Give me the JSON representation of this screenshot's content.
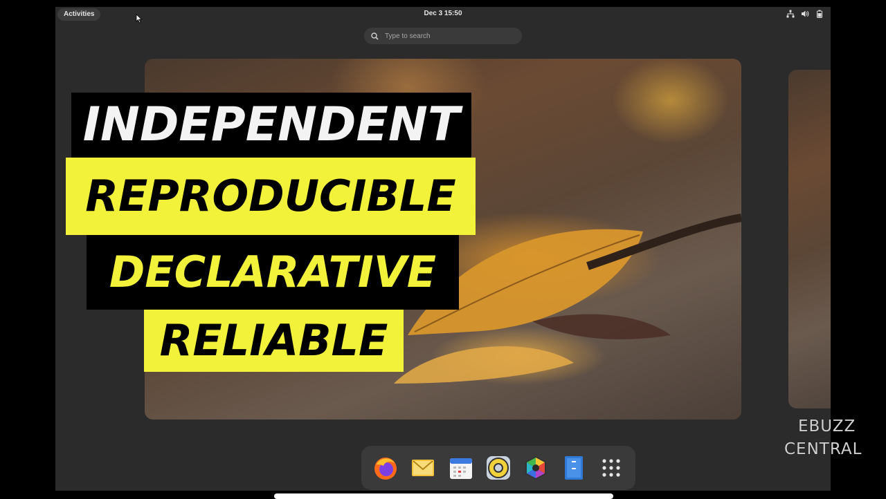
{
  "topbar": {
    "activities_label": "Activities",
    "clock": "Dec 3  15:50",
    "tray": [
      "network-icon",
      "volume-icon",
      "battery-icon"
    ]
  },
  "search": {
    "placeholder": "Type to search"
  },
  "overlay": {
    "line1": "INDEPENDENT",
    "line2": "REPRODUCIBLE",
    "line3": "DECLARATIVE",
    "line4": "RELIABLE"
  },
  "colors": {
    "highlight_yellow": "#f2f23a",
    "panel_bg": "#2b2b2b",
    "dock_bg": "#3a3a3a"
  },
  "dock": {
    "items": [
      {
        "name": "firefox-icon",
        "interactable": true
      },
      {
        "name": "mail-icon",
        "interactable": true
      },
      {
        "name": "calendar-icon",
        "interactable": true
      },
      {
        "name": "rhythmbox-icon",
        "interactable": true
      },
      {
        "name": "photos-icon",
        "interactable": true
      },
      {
        "name": "files-icon",
        "interactable": true
      },
      {
        "name": "show-apps-icon",
        "interactable": true
      }
    ]
  },
  "watermark": {
    "line1": "EBUZZ",
    "line2": "CENTRAL"
  }
}
